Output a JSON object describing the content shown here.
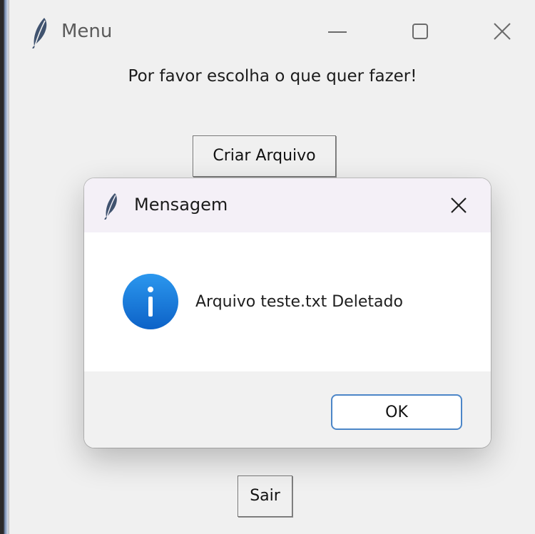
{
  "main_window": {
    "title": "Menu",
    "icon": "feather-icon",
    "controls": {
      "minimize": "minimize-icon",
      "maximize": "maximize-icon",
      "close": "close-icon"
    },
    "prompt": "Por favor escolha o que quer fazer!",
    "buttons": {
      "create_file": "Criar Arquivo",
      "exit": "Sair"
    }
  },
  "message_dialog": {
    "title": "Mensagem",
    "icon": "feather-icon",
    "close": "close-icon",
    "info_icon": "info-icon",
    "message": "Arquivo teste.txt Deletado",
    "ok_label": "OK"
  },
  "colors": {
    "window_background": "#f0f0f0",
    "dialog_header": "#f4f0f7",
    "dialog_body": "#ffffff",
    "dialog_footer": "#f1f1f1",
    "info_blue": "#1677d7",
    "focus_border": "#4c86c8"
  }
}
